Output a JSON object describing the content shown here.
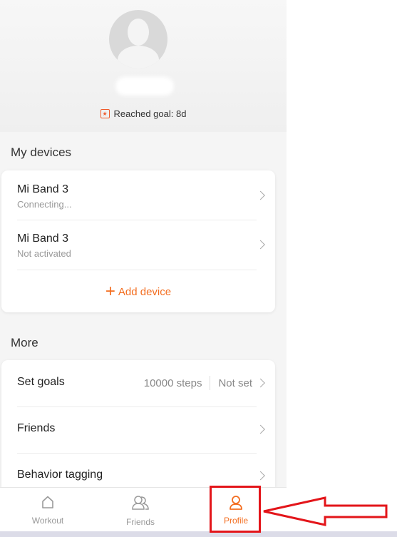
{
  "profile": {
    "goal_text": "Reached goal: 8d"
  },
  "devices": {
    "title": "My devices",
    "items": [
      {
        "name": "Mi Band 3",
        "status": "Connecting..."
      },
      {
        "name": "Mi Band 3",
        "status": "Not activated"
      }
    ],
    "add_label": "Add device"
  },
  "more": {
    "title": "More",
    "items": [
      {
        "label": "Set goals",
        "value1": "10000 steps",
        "value2": "Not set"
      },
      {
        "label": "Friends"
      },
      {
        "label": "Behavior tagging"
      }
    ]
  },
  "nav": {
    "tabs": [
      {
        "label": "Workout",
        "icon": "home-icon",
        "active": false
      },
      {
        "label": "Friends",
        "icon": "friends-icon",
        "active": false
      },
      {
        "label": "Profile",
        "icon": "profile-icon",
        "active": true
      }
    ]
  },
  "colors": {
    "accent": "#f36d1f",
    "annotation": "#e3151a"
  }
}
